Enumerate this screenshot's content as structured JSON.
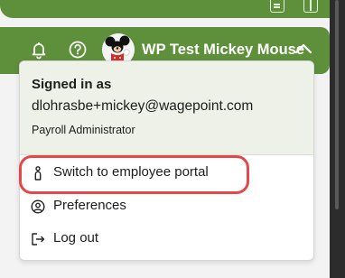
{
  "header": {
    "user_name": "WP Test Mickey Mouse",
    "bell_icon": "bell-icon",
    "help_icon": "help-circle-icon",
    "avatar_icon": "mickey-mouse-avatar",
    "chevron_icon": "chevron-up-icon",
    "brand_color": "#5e8f3a"
  },
  "dropdown": {
    "signed_in_label": "Signed in as",
    "email": "dlohrasbe+mickey@wagepoint.com",
    "role": "Payroll Administrator",
    "items": [
      {
        "label": "Switch to employee portal",
        "icon": "person-icon"
      },
      {
        "label": "Preferences",
        "icon": "user-circle-icon"
      },
      {
        "label": "Log out",
        "icon": "logout-icon"
      }
    ]
  },
  "annotation": {
    "highlight_color": "#e44848"
  }
}
